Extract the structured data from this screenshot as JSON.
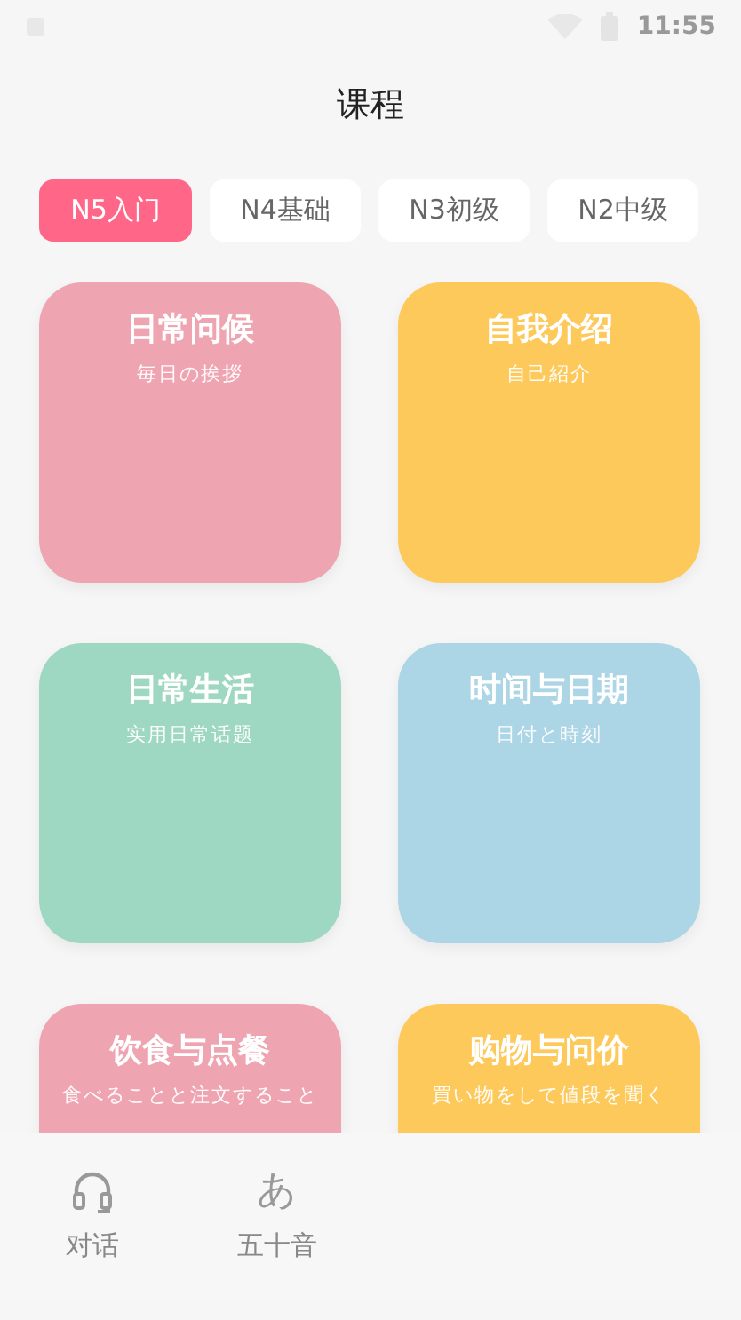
{
  "status_bar": {
    "time": "11:55"
  },
  "header": {
    "title": "课程"
  },
  "tabs": [
    {
      "label": "N5入门",
      "selected": true
    },
    {
      "label": "N4基础",
      "selected": false
    },
    {
      "label": "N3初级",
      "selected": false
    },
    {
      "label": "N2中级",
      "selected": false
    }
  ],
  "courses": [
    {
      "title": "日常问候",
      "subtitle": "毎日の挨拶",
      "color": "#eea5b1"
    },
    {
      "title": "自我介绍",
      "subtitle": "自己紹介",
      "color": "#fdc95a"
    },
    {
      "title": "日常生活",
      "subtitle": "实用日常话题",
      "color": "#9fd8c2"
    },
    {
      "title": "时间与日期",
      "subtitle": "日付と時刻",
      "color": "#acd5e6"
    },
    {
      "title": "饮食与点餐",
      "subtitle": "食べることと注文すること",
      "color": "#eea5b1"
    },
    {
      "title": "购物与问价",
      "subtitle": "買い物をして値段を聞く",
      "color": "#fdc95a"
    }
  ],
  "bottom_nav": [
    {
      "kind": "headphones",
      "label": "对话"
    },
    {
      "kind": "glyph",
      "glyph": "あ",
      "label": "五十音"
    }
  ]
}
